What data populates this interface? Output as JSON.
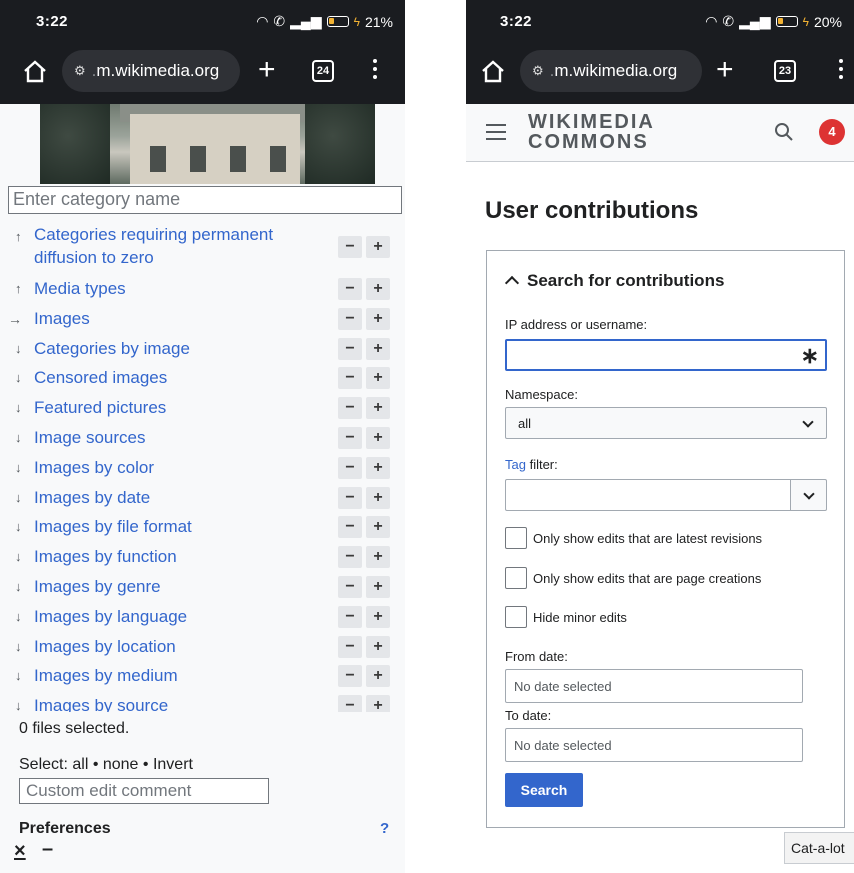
{
  "left": {
    "status": {
      "time": "3:22",
      "battery": "21%"
    },
    "browser": {
      "url_dim": ".",
      "url": "m.wikimedia.org",
      "tab_count": "24"
    },
    "cat_input_placeholder": "Enter category name",
    "categories": [
      {
        "arrow": "↑",
        "label": "Categories requiring permanent diffusion to zero"
      },
      {
        "arrow": "↑",
        "label": "Media types"
      },
      {
        "arrow": "→",
        "label": "Images"
      },
      {
        "arrow": "↓",
        "label": "Categories by image"
      },
      {
        "arrow": "↓",
        "label": "Censored images"
      },
      {
        "arrow": "↓",
        "label": "Featured pictures"
      },
      {
        "arrow": "↓",
        "label": "Image sources"
      },
      {
        "arrow": "↓",
        "label": "Images by color"
      },
      {
        "arrow": "↓",
        "label": "Images by date"
      },
      {
        "arrow": "↓",
        "label": "Images by file format"
      },
      {
        "arrow": "↓",
        "label": "Images by function"
      },
      {
        "arrow": "↓",
        "label": "Images by genre"
      },
      {
        "arrow": "↓",
        "label": "Images by language"
      },
      {
        "arrow": "↓",
        "label": "Images by location"
      },
      {
        "arrow": "↓",
        "label": "Images by medium"
      },
      {
        "arrow": "↓",
        "label": "Images by source"
      }
    ],
    "minus_label": "−",
    "plus_label": "+",
    "files_selected": "0 files selected.",
    "select_line": "Select: all • none • Invert",
    "comment_placeholder": "Custom edit comment",
    "preferences": "Preferences",
    "help": "?",
    "close": "×",
    "minimize": "–"
  },
  "right": {
    "status": {
      "time": "3:22",
      "battery": "20%"
    },
    "browser": {
      "url_dim": ".",
      "url": "m.wikimedia.org",
      "tab_count": "23"
    },
    "logo_line1": "WIKIMEDIA",
    "logo_line2": "COMMONS",
    "notification_count": "4",
    "page_title": "User contributions",
    "legend": "Search for contributions",
    "ip_label": "IP address or username:",
    "required_mark": "∗",
    "namespace_label": "Namespace:",
    "namespace_value": "all",
    "tag_link": "Tag",
    "tag_rest": " filter:",
    "checkboxes": [
      "Only show edits that are latest revisions",
      "Only show edits that are page creations",
      "Hide minor edits"
    ],
    "from_label": "From date:",
    "from_value": "No date selected",
    "to_label": "To date:",
    "to_value": "No date selected",
    "search_button": "Search",
    "catalot_tab": "Cat-a-lot"
  }
}
